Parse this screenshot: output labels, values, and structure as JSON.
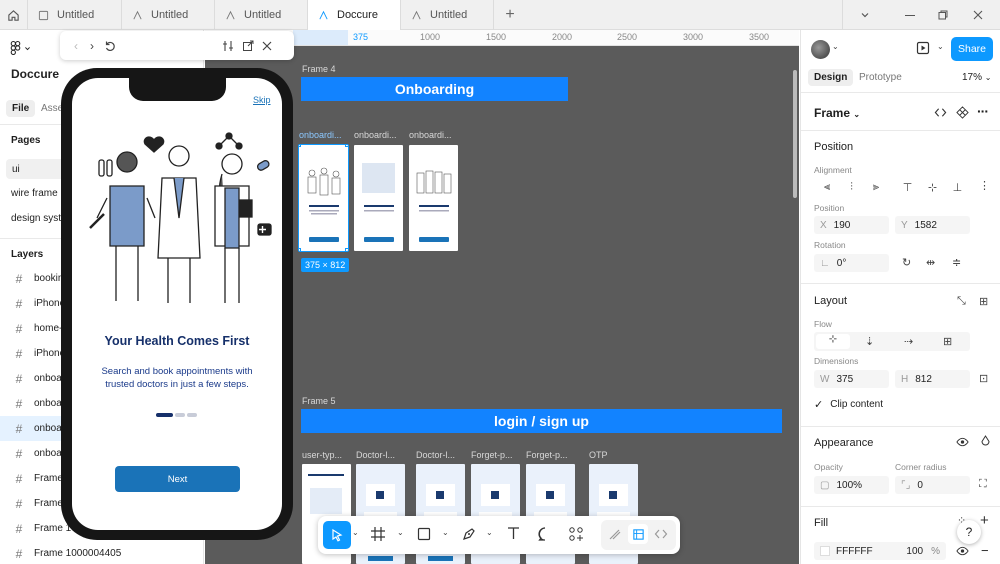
{
  "tabs": [
    {
      "label": "Untitled",
      "active": false
    },
    {
      "label": "Untitled",
      "active": false
    },
    {
      "label": "Untitled",
      "active": false
    },
    {
      "label": "Doccure",
      "active": true
    },
    {
      "label": "Untitled",
      "active": false
    }
  ],
  "file_name": "Doccure",
  "left_panel": {
    "tab_file": "File",
    "tab_assets": "Asse",
    "pages_title": "Pages",
    "pages": [
      "ui",
      "wire frame",
      "design syste"
    ],
    "layers_title": "Layers",
    "layers": [
      "booking",
      "iPhone",
      "home-c",
      "iPhone",
      "onboar",
      "onboar",
      "onboar",
      "onboar",
      "Frame 1",
      "Frame 1",
      "Frame 100",
      "Frame 1000004405"
    ]
  },
  "ruler": {
    "ticks": [
      "375",
      "1000",
      "1500",
      "2000",
      "2500",
      "3000",
      "3500"
    ]
  },
  "canvas": {
    "frame4_label": "Frame 4",
    "onboarding_title": "Onboarding",
    "onboarding_frame_labels": [
      "onboardi...",
      "onboardi...",
      "onboardi..."
    ],
    "selection_size": "375 × 812",
    "frame5_label": "Frame 5",
    "login_title": "login / sign up",
    "login_frame_labels": [
      "user-typ...",
      "Doctor-l...",
      "Doctor-l...",
      "Forget-p...",
      "Forget-p...",
      "OTP"
    ]
  },
  "phone": {
    "skip": "Skip",
    "headline": "Your Health Comes First",
    "body": "Search and book appointments with trusted doctors in just a few steps.",
    "next": "Next"
  },
  "right_panel": {
    "share": "Share",
    "tab_design": "Design",
    "tab_prototype": "Prototype",
    "zoom": "17%",
    "frame_title": "Frame",
    "position_title": "Position",
    "alignment_label": "Alignment",
    "position_label": "Position",
    "x_label": "X",
    "x_value": "190",
    "y_label": "Y",
    "y_value": "1582",
    "rotation_label": "Rotation",
    "rotation_value": "0°",
    "layout_title": "Layout",
    "flow_label": "Flow",
    "dimensions_label": "Dimensions",
    "w_label": "W",
    "w_value": "375",
    "h_label": "H",
    "h_value": "812",
    "clip_content": "Clip content",
    "appearance_title": "Appearance",
    "opacity_label": "Opacity",
    "opacity_value": "100%",
    "corner_label": "Corner radius",
    "corner_value": "0",
    "fill_title": "Fill",
    "fill_hex": "FFFFFF",
    "fill_opacity": "100",
    "fill_pct": "%",
    "help": "?"
  },
  "colors": {
    "accent": "#0d99ff",
    "brand_blue": "#1283ff",
    "phone_primary": "#1a73b8",
    "canvas": "#5b5b5b"
  }
}
